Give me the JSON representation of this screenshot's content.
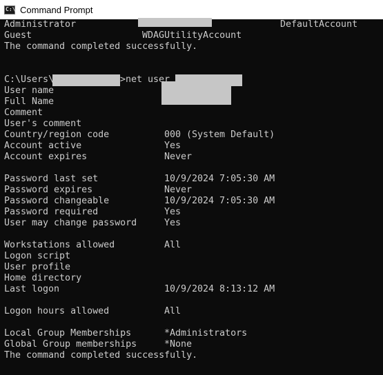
{
  "window": {
    "title": "Command Prompt",
    "icon": "cmd-app-icon",
    "icon_glyph": "C:\\",
    "background": "#0c0c0c",
    "text_color": "#cccccc",
    "redaction_color": "#c6c6c6"
  },
  "console": {
    "accounts_row1": {
      "col1": "Administrator",
      "col3": "DefaultAccount"
    },
    "accounts_row2": {
      "col1": "Guest",
      "col2": "WDAGUtilityAccount"
    },
    "completed_1": "The command completed successfully.",
    "prompt": {
      "path_prefix": "C:\\Users\\",
      "command": ">net user"
    },
    "fields": {
      "user_name": {
        "label": "User name",
        "value": ""
      },
      "full_name": {
        "label": "Full Name",
        "value": ""
      },
      "comment": {
        "label": "Comment",
        "value": ""
      },
      "users_comment": {
        "label": "User's comment",
        "value": ""
      },
      "country_region_code": {
        "label": "Country/region code",
        "value": "000 (System Default)"
      },
      "account_active": {
        "label": "Account active",
        "value": "Yes"
      },
      "account_expires": {
        "label": "Account expires",
        "value": "Never"
      },
      "password_last_set": {
        "label": "Password last set",
        "value": "10/9/2024 7:05:30 AM"
      },
      "password_expires": {
        "label": "Password expires",
        "value": "Never"
      },
      "password_changeable": {
        "label": "Password changeable",
        "value": "10/9/2024 7:05:30 AM"
      },
      "password_required": {
        "label": "Password required",
        "value": "Yes"
      },
      "user_may_change_password": {
        "label": "User may change password",
        "value": "Yes"
      },
      "workstations_allowed": {
        "label": "Workstations allowed",
        "value": "All"
      },
      "logon_script": {
        "label": "Logon script",
        "value": ""
      },
      "user_profile": {
        "label": "User profile",
        "value": ""
      },
      "home_directory": {
        "label": "Home directory",
        "value": ""
      },
      "last_logon": {
        "label": "Last logon",
        "value": "10/9/2024 8:13:12 AM"
      },
      "logon_hours_allowed": {
        "label": "Logon hours allowed",
        "value": "All"
      },
      "local_group_memberships": {
        "label": "Local Group Memberships",
        "value": "*Administrators"
      },
      "global_group_memberships": {
        "label": "Global Group memberships",
        "value": "*None"
      }
    },
    "completed_2": "The command completed successfully."
  }
}
